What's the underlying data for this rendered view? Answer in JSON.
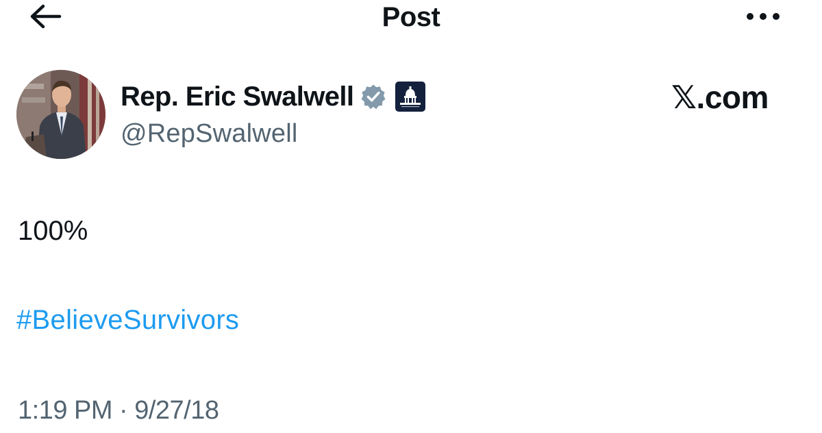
{
  "header": {
    "title": "Post",
    "back_icon": "arrow-left-icon",
    "more_icon": "more-horizontal-icon"
  },
  "author": {
    "display_name": "Rep. Eric Swalwell",
    "handle": "@RepSwalwell",
    "verified_badge": "verified-badge-icon",
    "verified_color": "#829aab",
    "affiliation_badge": "capitol-building-icon",
    "affiliation_color": "#14213d",
    "avatar": "avatar-photo"
  },
  "watermark": "𝕏.com",
  "post": {
    "line1": "100%",
    "hashtag": "#BelieveSurvivors",
    "hashtag_color": "#1d9bf0"
  },
  "meta": {
    "time": "1:19 PM",
    "separator": "·",
    "date": "9/27/18"
  }
}
